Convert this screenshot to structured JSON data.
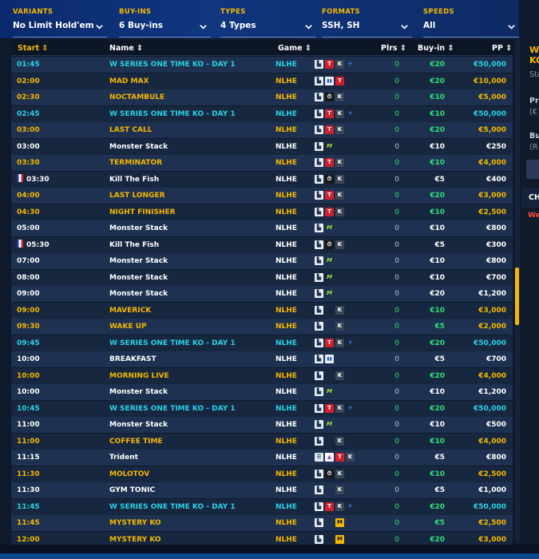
{
  "filters": [
    {
      "label": "VARIANTS",
      "value": "No Limit Hold'em"
    },
    {
      "label": "BUY-INS",
      "value": "6 Buy-ins"
    },
    {
      "label": "TYPES",
      "value": "4 Types"
    },
    {
      "label": "FORMATS",
      "value": "SSH, SH"
    },
    {
      "label": "SPEEDS",
      "value": "All"
    }
  ],
  "columns": {
    "start": "Start ⇕",
    "name": "Name ⇕",
    "game": "Game ⇕",
    "plrs": "Plrs ⇕",
    "buyin": "Buy-in ⇕",
    "pp": "PP ⇕"
  },
  "colors": {
    "gold": "#f5b800",
    "teal": "#29d3e6",
    "white": "#ffffff",
    "accent_green": "#2be07a"
  },
  "rows": [
    {
      "start": "01:45",
      "name": "W SERIES ONE TIME KO - DAY 1",
      "game": "NLHE",
      "icons": [
        "B",
        "T",
        "K",
        "A"
      ],
      "plrs": "0",
      "buyin": "€20",
      "pp": "€50,000",
      "style": "teal"
    },
    {
      "start": "02:00",
      "name": "MAD MAX",
      "game": "NLHE",
      "icons": [
        "B",
        "G",
        "T"
      ],
      "plrs": "0",
      "buyin": "€20",
      "pp": "€10,000",
      "style": "gold"
    },
    {
      "start": "02:30",
      "name": "NOCTAMBULE",
      "game": "NLHE",
      "icons": [
        "B",
        "R",
        "K"
      ],
      "plrs": "0",
      "buyin": "€10",
      "pp": "€5,000",
      "style": "gold"
    },
    {
      "start": "02:45",
      "name": "W SERIES ONE TIME KO - DAY 1",
      "game": "NLHE",
      "icons": [
        "B",
        "T",
        "K",
        "A"
      ],
      "plrs": "0",
      "buyin": "€10",
      "pp": "€50,000",
      "style": "teal"
    },
    {
      "start": "03:00",
      "name": "LAST CALL",
      "game": "NLHE",
      "icons": [
        "B",
        "T",
        "K"
      ],
      "plrs": "0",
      "buyin": "€20",
      "pp": "€5,000",
      "style": "gold"
    },
    {
      "start": "03:00",
      "name": "Monster Stack",
      "game": "NLHE",
      "icons": [
        "B",
        "M"
      ],
      "plrs": "0",
      "buyin": "€10",
      "pp": "€250",
      "style": "white"
    },
    {
      "start": "03:30",
      "name": "TERMINATOR",
      "game": "NLHE",
      "icons": [
        "B",
        "T",
        "K"
      ],
      "plrs": "0",
      "buyin": "€10",
      "pp": "€4,000",
      "style": "gold"
    },
    {
      "start": "03:30",
      "name": "Kill The Fish",
      "game": "NLHE",
      "icons": [
        "B",
        "R",
        "K"
      ],
      "plrs": "0",
      "buyin": "€5",
      "pp": "€400",
      "style": "white",
      "flag": true
    },
    {
      "start": "04:00",
      "name": "LAST LONGER",
      "game": "NLHE",
      "icons": [
        "B",
        "T",
        "K"
      ],
      "plrs": "0",
      "buyin": "€20",
      "pp": "€3,000",
      "style": "gold"
    },
    {
      "start": "04:30",
      "name": "NIGHT FINISHER",
      "game": "NLHE",
      "icons": [
        "B",
        "T",
        "K"
      ],
      "plrs": "0",
      "buyin": "€10",
      "pp": "€2,500",
      "style": "gold"
    },
    {
      "start": "05:00",
      "name": "Monster Stack",
      "game": "NLHE",
      "icons": [
        "B",
        "M"
      ],
      "plrs": "0",
      "buyin": "€10",
      "pp": "€800",
      "style": "white"
    },
    {
      "start": "05:30",
      "name": "Kill The Fish",
      "game": "NLHE",
      "icons": [
        "B",
        "R",
        "K"
      ],
      "plrs": "0",
      "buyin": "€5",
      "pp": "€300",
      "style": "white",
      "flag": true
    },
    {
      "start": "07:00",
      "name": "Monster Stack",
      "game": "NLHE",
      "icons": [
        "B",
        "M"
      ],
      "plrs": "0",
      "buyin": "€10",
      "pp": "€800",
      "style": "white"
    },
    {
      "start": "08:00",
      "name": "Monster Stack",
      "game": "NLHE",
      "icons": [
        "B",
        "M"
      ],
      "plrs": "0",
      "buyin": "€10",
      "pp": "€700",
      "style": "white"
    },
    {
      "start": "09:00",
      "name": "Monster Stack",
      "game": "NLHE",
      "icons": [
        "B",
        "M"
      ],
      "plrs": "0",
      "buyin": "€20",
      "pp": "€1,200",
      "style": "white"
    },
    {
      "start": "09:00",
      "name": "MAVERICK",
      "game": "NLHE",
      "icons": [
        "B",
        "",
        "K"
      ],
      "plrs": "0",
      "buyin": "€10",
      "pp": "€3,000",
      "style": "gold"
    },
    {
      "start": "09:30",
      "name": "WAKE UP",
      "game": "NLHE",
      "icons": [
        "B",
        "",
        "K"
      ],
      "plrs": "0",
      "buyin": "€5",
      "pp": "€2,000",
      "style": "gold"
    },
    {
      "start": "09:45",
      "name": "W SERIES ONE TIME KO - DAY 1",
      "game": "NLHE",
      "icons": [
        "B",
        "T",
        "K",
        "A"
      ],
      "plrs": "0",
      "buyin": "€20",
      "pp": "€50,000",
      "style": "teal"
    },
    {
      "start": "10:00",
      "name": "BREAKFAST",
      "game": "NLHE",
      "icons": [
        "B",
        "G"
      ],
      "plrs": "0",
      "buyin": "€5",
      "pp": "€700",
      "style": "white"
    },
    {
      "start": "10:00",
      "name": "MORNING LIVE",
      "game": "NLHE",
      "icons": [
        "B",
        "",
        "K"
      ],
      "plrs": "0",
      "buyin": "€20",
      "pp": "€4,000",
      "style": "gold"
    },
    {
      "start": "10:00",
      "name": "Monster Stack",
      "game": "NLHE",
      "icons": [
        "B",
        "M"
      ],
      "plrs": "0",
      "buyin": "€10",
      "pp": "€1,200",
      "style": "white"
    },
    {
      "start": "10:45",
      "name": "W SERIES ONE TIME KO - DAY 1",
      "game": "NLHE",
      "icons": [
        "B",
        "T",
        "K",
        "A"
      ],
      "plrs": "0",
      "buyin": "€20",
      "pp": "€50,000",
      "style": "teal"
    },
    {
      "start": "11:00",
      "name": "Monster Stack",
      "game": "NLHE",
      "icons": [
        "B",
        "M"
      ],
      "plrs": "0",
      "buyin": "€10",
      "pp": "€500",
      "style": "white"
    },
    {
      "start": "11:00",
      "name": "COFFEE TIME",
      "game": "NLHE",
      "icons": [
        "B",
        "",
        "K"
      ],
      "plrs": "0",
      "buyin": "€10",
      "pp": "€4,000",
      "style": "gold"
    },
    {
      "start": "11:15",
      "name": "Trident",
      "game": "NLHE",
      "icons": [
        "E",
        "TR",
        "T",
        "K"
      ],
      "plrs": "0",
      "buyin": "€5",
      "pp": "€800",
      "style": "white"
    },
    {
      "start": "11:30",
      "name": "MOLOTOV",
      "game": "NLHE",
      "icons": [
        "B",
        "R",
        "K"
      ],
      "plrs": "0",
      "buyin": "€10",
      "pp": "€2,500",
      "style": "gold"
    },
    {
      "start": "11:30",
      "name": "GYM TONIC",
      "game": "NLHE",
      "icons": [
        "B",
        "",
        "K"
      ],
      "plrs": "0",
      "buyin": "€5",
      "pp": "€1,000",
      "style": "white"
    },
    {
      "start": "11:45",
      "name": "W SERIES ONE TIME KO - DAY 1",
      "game": "NLHE",
      "icons": [
        "B",
        "T",
        "K",
        "A"
      ],
      "plrs": "0",
      "buyin": "€20",
      "pp": "€50,000",
      "style": "teal"
    },
    {
      "start": "11:45",
      "name": "MYSTERY KO",
      "game": "NLHE",
      "icons": [
        "B",
        "",
        "MO"
      ],
      "plrs": "0",
      "buyin": "€5",
      "pp": "€2,500",
      "style": "gold"
    },
    {
      "start": "12:00",
      "name": "MYSTERY KO",
      "game": "NLHE",
      "icons": [
        "B",
        "",
        "MO"
      ],
      "plrs": "0",
      "buyin": "€20",
      "pp": "€3,000",
      "style": "gold"
    }
  ],
  "side_panel": {
    "title": "W",
    "title2": "KO",
    "line1": "Sta",
    "line2": "Pri",
    "line3": "(€",
    "line4": "Bu",
    "line5": "(R",
    "section": "CH",
    "red_text": "We"
  }
}
